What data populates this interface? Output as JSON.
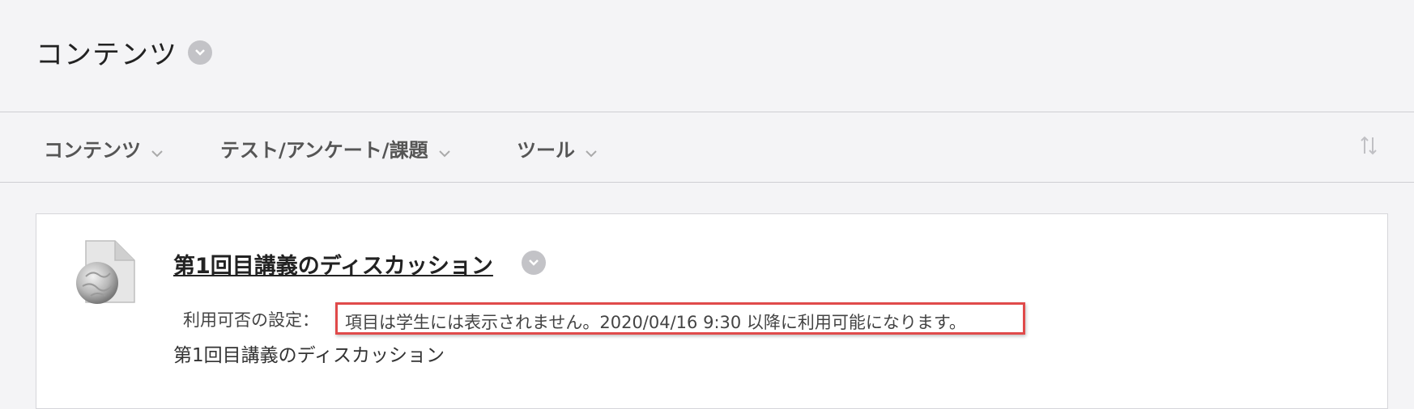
{
  "header": {
    "title": "コンテンツ"
  },
  "action_bar": {
    "menus": [
      {
        "label": "コンテンツ"
      },
      {
        "label": "テスト/アンケート/課題"
      },
      {
        "label": "ツール"
      }
    ]
  },
  "content_item": {
    "title": "第1回目講義のディスカッション",
    "availability_label": "利用可否の設定：",
    "availability_value": "項目は学生には表示されません。2020/04/16 9:30 以降に利用可能になります。",
    "description": "第1回目講義のディスカッション",
    "icon": "discussion-globe-document-icon"
  },
  "colors": {
    "highlight_border": "#e04a4a",
    "background": "#f4f4f6",
    "card_background": "#ffffff"
  }
}
